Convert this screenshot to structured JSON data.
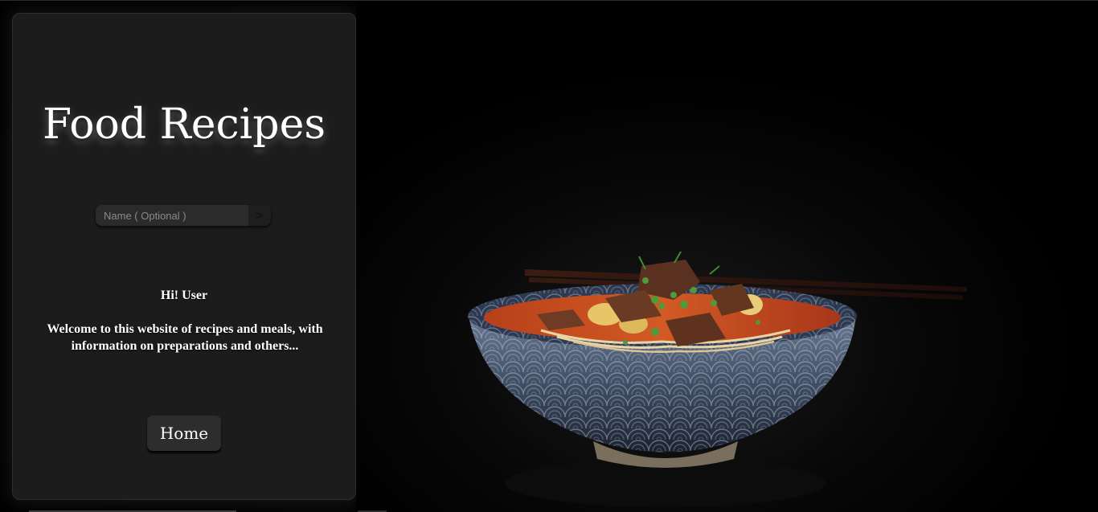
{
  "panel": {
    "title": "Food Recipes",
    "name_input": {
      "value": "",
      "placeholder": "Name ( Optional )"
    },
    "submit_label": ">",
    "greeting": "Hi! User",
    "welcome_text": "Welcome to this website of recipes and meals, with information on preparations and others...",
    "home_button_label": "Home"
  },
  "photo": {
    "subject": "bowl-of-noodle-soup-image"
  },
  "colors": {
    "page_background": "#000000",
    "panel_background": "#1c1c1c",
    "text": "#ffffff",
    "button_background": "#2d2d2d"
  }
}
